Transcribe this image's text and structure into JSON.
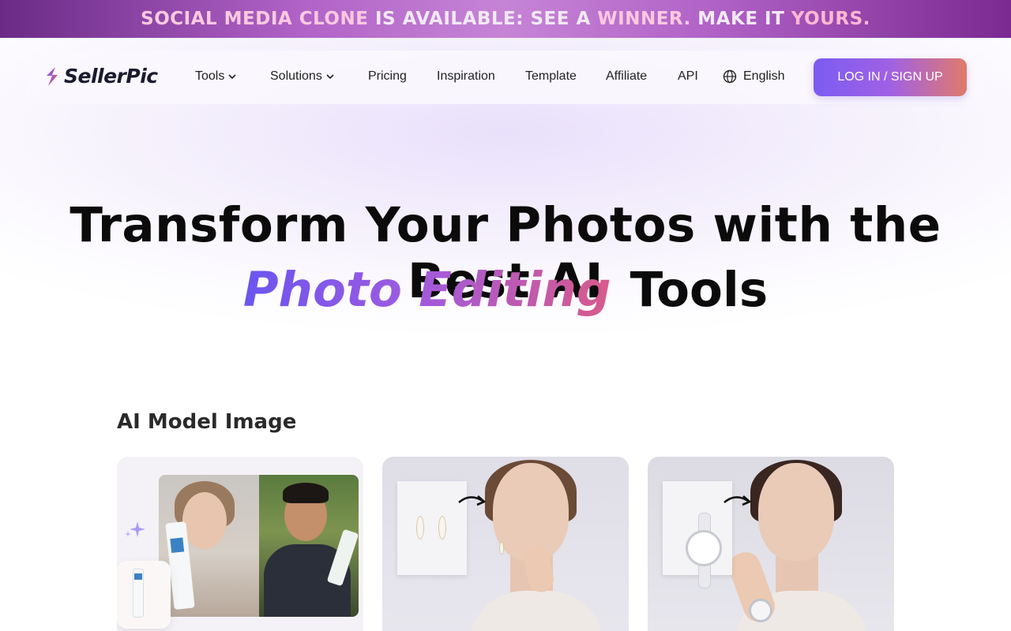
{
  "promo": {
    "part1": "SOCIAL MEDIA CLONE",
    "part2": " IS AVAILABLE: SEE A ",
    "part3": "WINNER.",
    "part4": " MAKE IT ",
    "part5": "YOURS."
  },
  "brand": {
    "name": "SellerPic"
  },
  "nav": {
    "tools": "Tools",
    "solutions": "Solutions",
    "pricing": "Pricing",
    "inspiration": "Inspiration",
    "template": "Template",
    "affiliate": "Affiliate",
    "api": "API",
    "language": "English",
    "login": "LOG IN / SIGN UP"
  },
  "hero": {
    "line1": "Transform Your Photos with the Best AI",
    "highlight": "Photo Editing",
    "line2_rest": "Tools"
  },
  "section": {
    "title": "AI Model Image"
  },
  "colors": {
    "accent_start": "#6a55f0",
    "accent_mid": "#9e5ae0",
    "accent_end": "#d85a8a",
    "promo_highlight": "#ffc9e0"
  }
}
